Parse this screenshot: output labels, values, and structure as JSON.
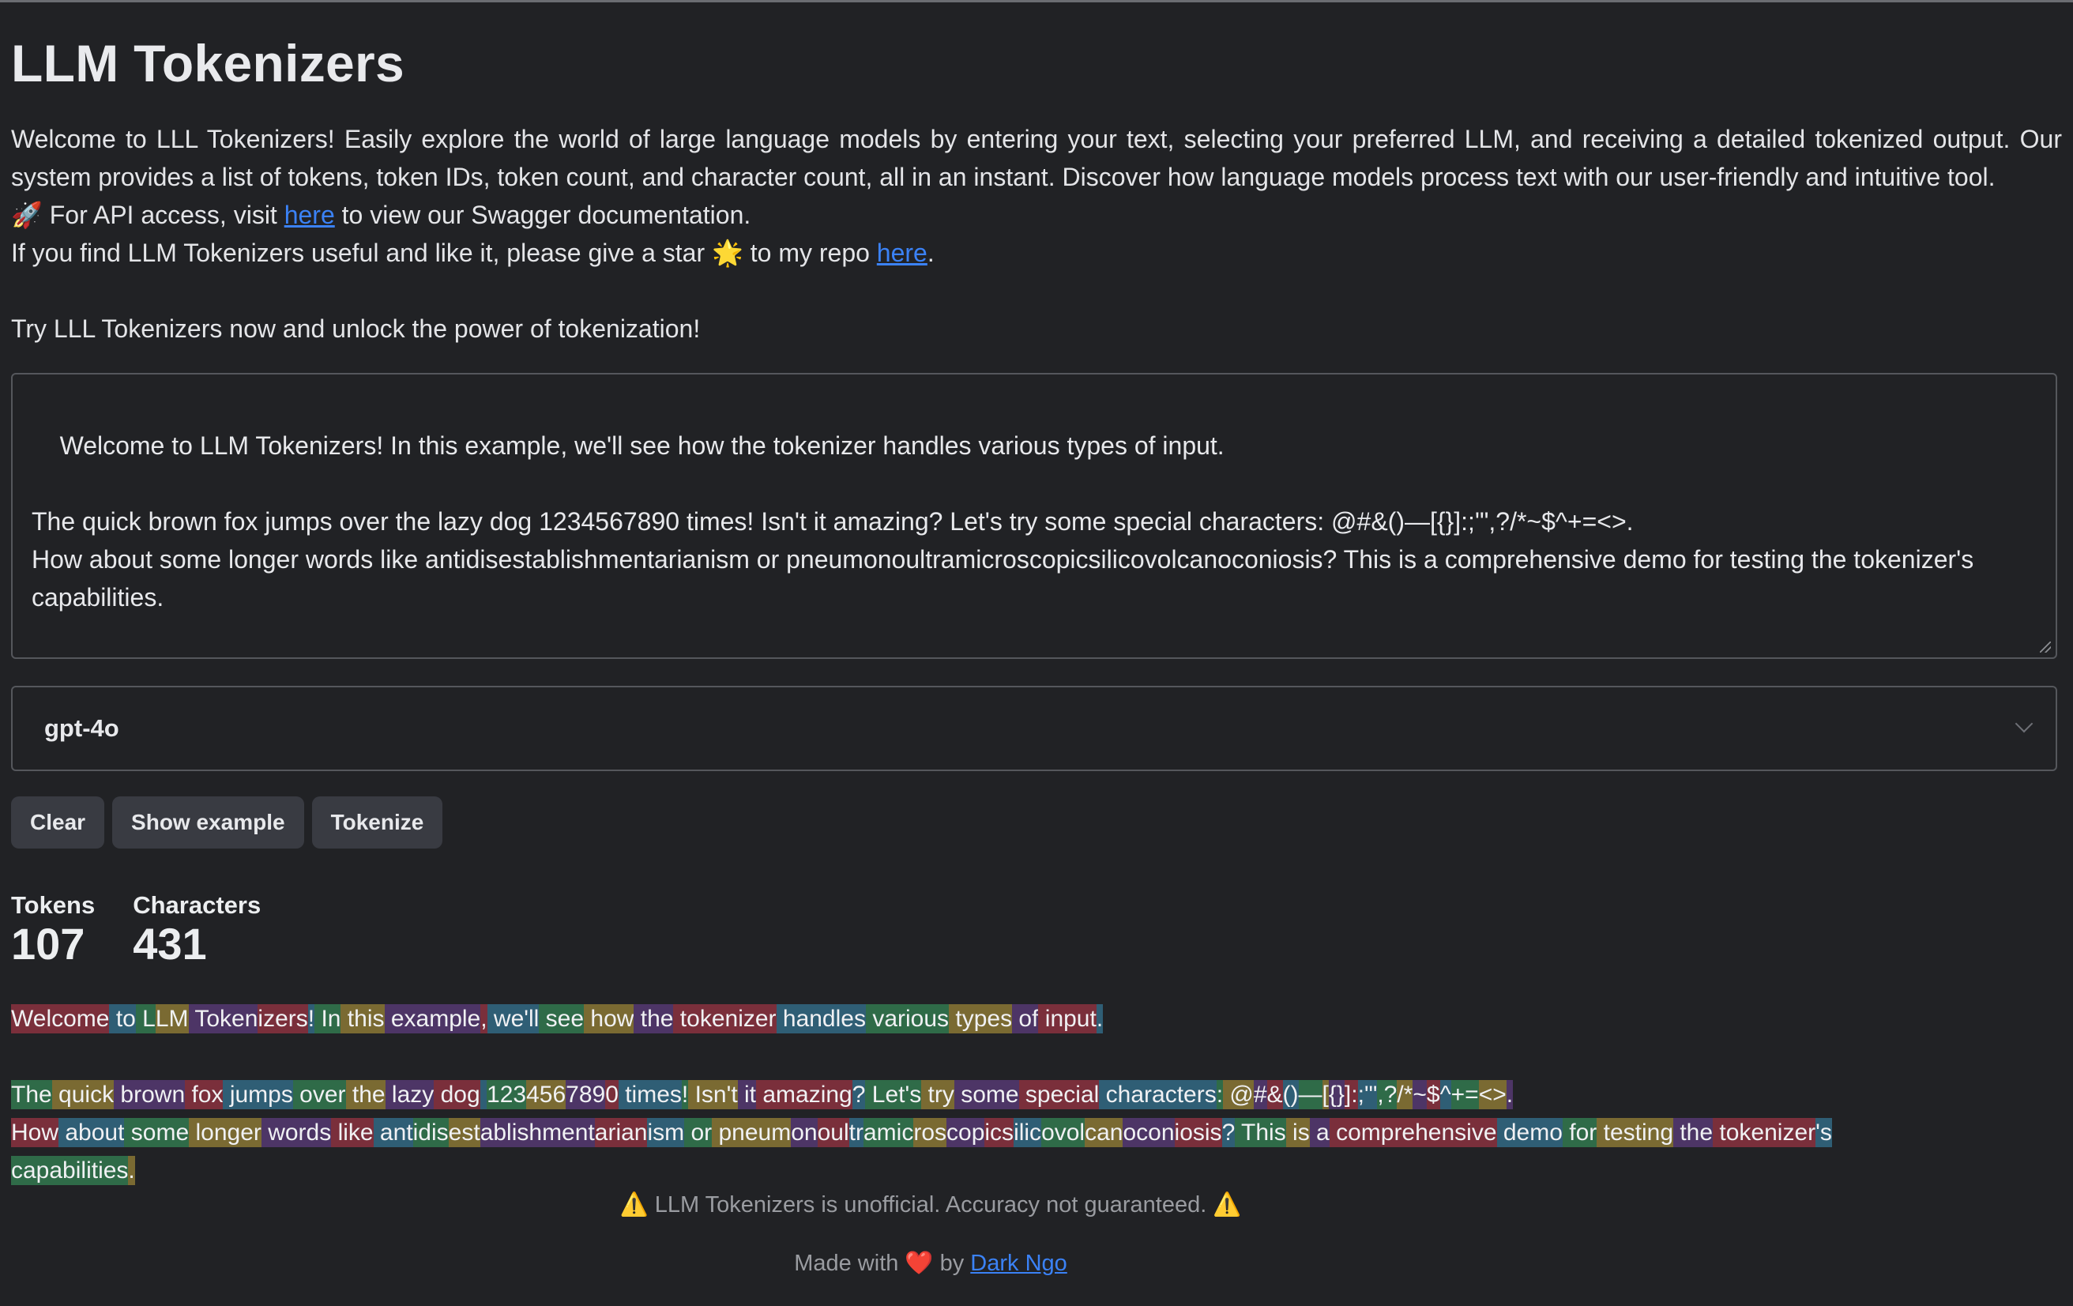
{
  "title": "LLM Tokenizers",
  "intro": {
    "p1": "Welcome to LLL Tokenizers! Easily explore the world of large language models by entering your text, selecting your preferred LLM, and receiving a detailed tokenized output. Our system provides a list of tokens, token IDs, token count, and character count, all in an instant. Discover how language models process text with our user-friendly and intuitive tool.",
    "api_prefix": "🚀 For API access, visit ",
    "api_link": "here",
    "api_suffix": " to view our Swagger documentation.",
    "star_prefix": "If you find LLM Tokenizers useful and like it, please give a star 🌟 to my repo ",
    "star_link": "here",
    "star_suffix": ".",
    "cta": "Try LLL Tokenizers now and unlock the power of tokenization!"
  },
  "input_text": "Welcome to LLM Tokenizers! In this example, we'll see how the tokenizer handles various types of input.\n\nThe quick brown fox jumps over the lazy dog 1234567890 times! Isn't it amazing? Let's try some special characters: @#&()—[{}]:;'\",?/*~$^+=<>.\nHow about some longer words like antidisestablishmentarianism or pneumonoultramicroscopicsilicovolcanoconiosis? This is a comprehensive demo for testing the tokenizer's capabilities.",
  "model": {
    "selected": "gpt-4o",
    "icon": "chevron-down-icon"
  },
  "buttons": {
    "clear": "Clear",
    "example": "Show example",
    "tokenize": "Tokenize"
  },
  "stats": {
    "tokens_label": "Tokens",
    "tokens_value": "107",
    "chars_label": "Characters",
    "chars_value": "431"
  },
  "token_colors": [
    "#7a2f3b",
    "#2f5e75",
    "#2f6b48",
    "#7a6a32",
    "#4d3566"
  ],
  "tokens": [
    "Welcome",
    " to",
    " L",
    "LM",
    " Token",
    "izers",
    "!",
    " In",
    " this",
    " example",
    ",",
    " we'll",
    " see",
    " how",
    " the",
    " tokenizer",
    " handles",
    " various",
    " types",
    " of",
    " input",
    ".",
    "\n\n",
    "The",
    " quick",
    " brown",
    " fox",
    " jumps",
    " over",
    " the",
    " lazy",
    " dog",
    " ",
    "123",
    "456",
    "789",
    "0",
    " times",
    "!",
    " Isn't",
    " it",
    " amazing",
    "?",
    " Let's",
    " try",
    " some",
    " special",
    " characters",
    ":",
    " @",
    "#",
    "&",
    "()",
    "—",
    "[",
    "{}",
    "]:",
    ";'\"",
    ",?",
    "/*",
    "~",
    "$",
    "^",
    "+=",
    "<>",
    ".",
    "\n",
    "How",
    " about",
    " some",
    " longer",
    " words",
    " like",
    " ant",
    "idis",
    "est",
    "ablishment",
    "arian",
    "ism",
    " or",
    " pneum",
    "on",
    "oul",
    "tr",
    "amic",
    "ros",
    "cop",
    "ics",
    "ilic",
    "ovol",
    "can",
    "ocon",
    "iosis",
    "?",
    " This",
    " is",
    " a",
    " comprehensive",
    " demo",
    " for",
    " testing",
    " the",
    " tokenizer",
    "'s",
    "\n",
    "capabilities",
    "."
  ],
  "footer": {
    "disclaimer": "⚠️ LLM Tokenizers is unofficial. Accuracy not guaranteed. ⚠️",
    "made_prefix": "Made with ❤️ by ",
    "author": "Dark Ngo"
  }
}
